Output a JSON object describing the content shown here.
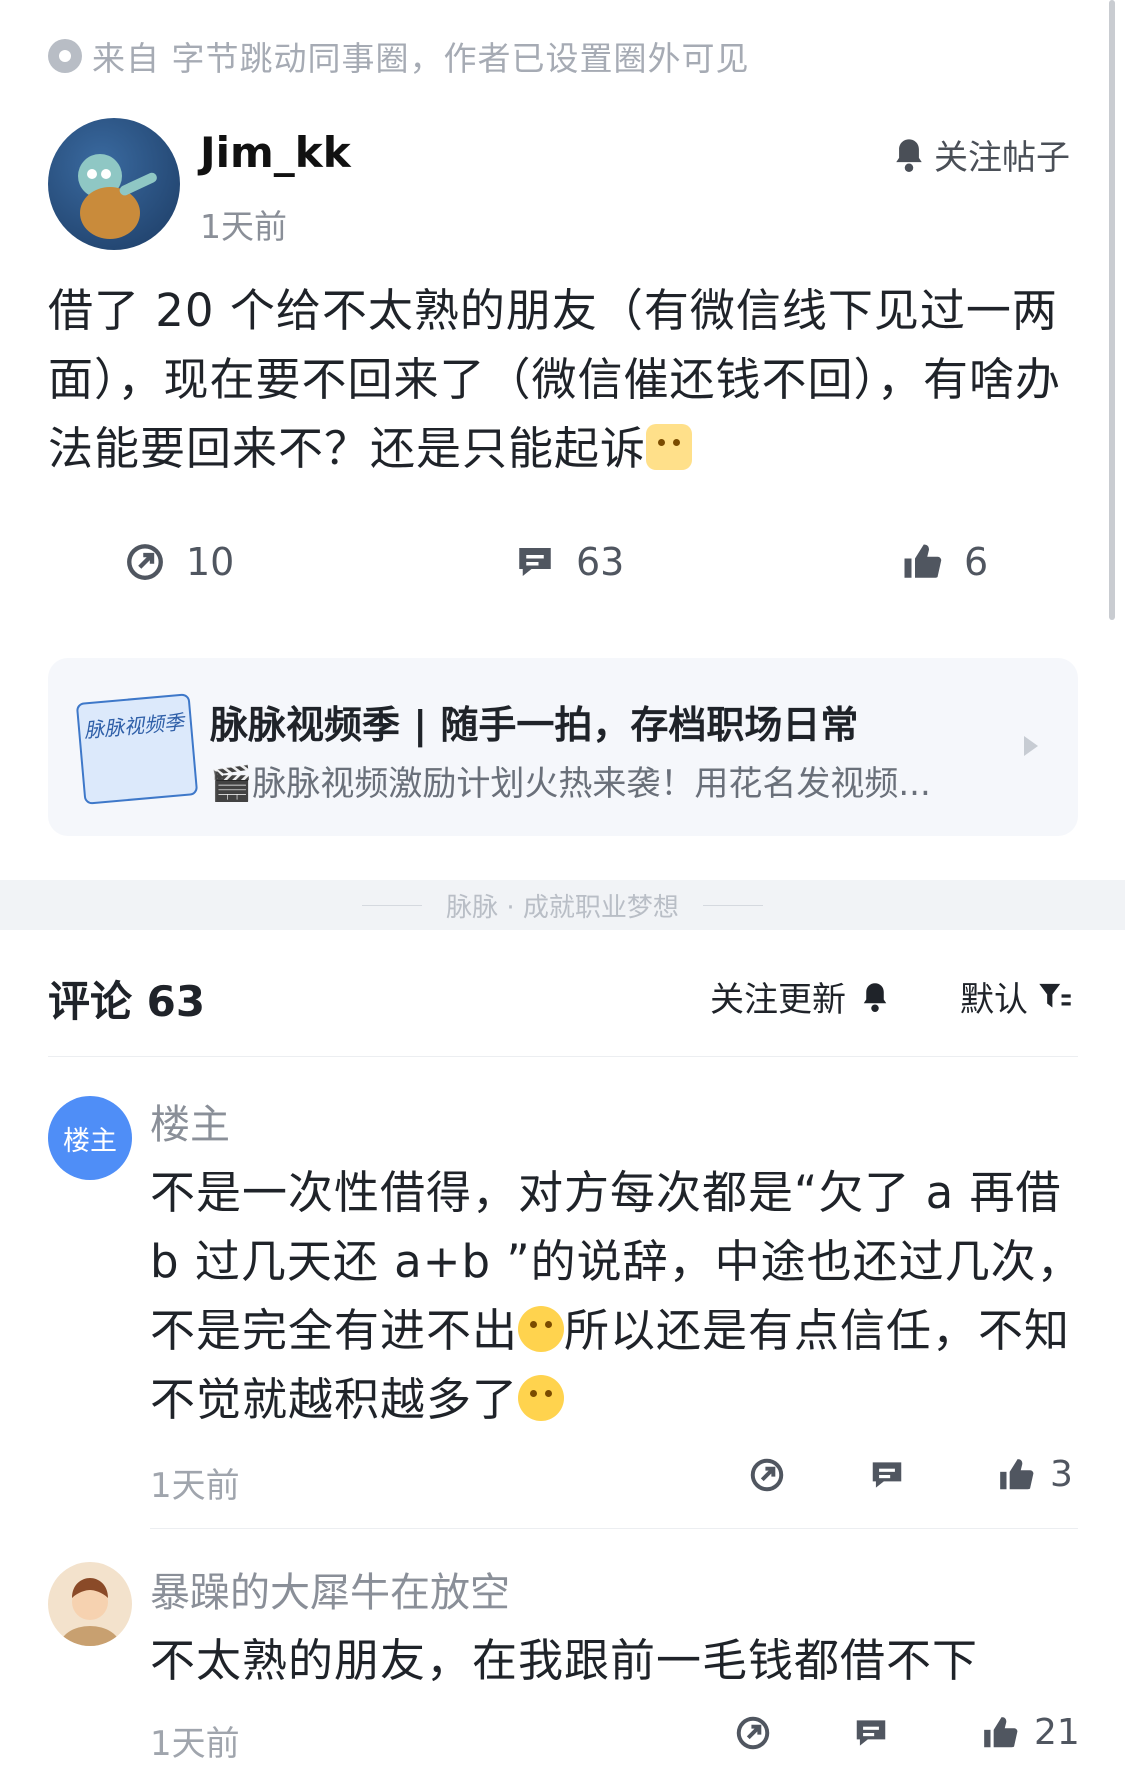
{
  "post": {
    "source_text": "来自 字节跳动同事圈，作者已设置圈外可见",
    "author": "Jim_kk",
    "time": "1天前",
    "follow_label": "关注帖子",
    "body": "借了 20 个给不太熟的朋友（有微信线下见过一两面），现在要不回来了（微信催还钱不回），有啥办法能要回来不？还是只能起诉",
    "stats": {
      "share": "10",
      "comments": "63",
      "likes": "6"
    }
  },
  "promo": {
    "image_text": "脉脉视频季",
    "title": "脉脉视频季 | 随手一拍，存档职场日常",
    "subtitle": "🎬脉脉视频激励计划火热来袭！用花名发视频..."
  },
  "divider": {
    "text": "脉脉 · 成就职业梦想"
  },
  "comments_section": {
    "title": "评论 63",
    "follow_updates": "关注更新",
    "sort": "默认",
    "items": [
      {
        "badge": "楼主",
        "author": "楼主",
        "body_parts": [
          "不是一次性借得，对方每次都是“欠了 a 再借 b 过几天还 a+b ”的说辞，中途也还过几次，不是完全有进不出",
          "所以还是有点信任，不知不觉就越积越多了"
        ],
        "time": "1天前",
        "likes": "3"
      },
      {
        "author": "暴躁的大犀牛在放空",
        "body": "不太熟的朋友，在我跟前一毛钱都借不下",
        "time": "1天前",
        "likes": "21"
      }
    ]
  }
}
